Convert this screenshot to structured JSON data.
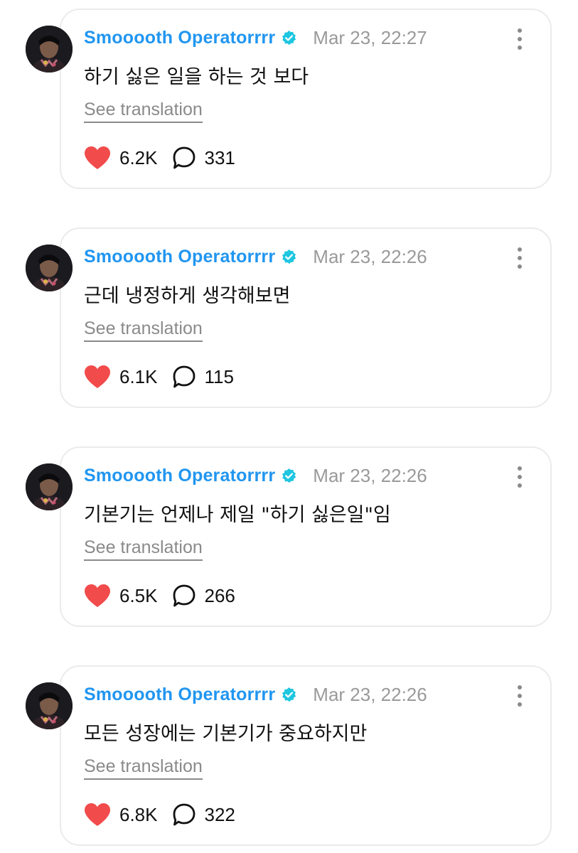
{
  "colors": {
    "accent": "#2196f0",
    "verified": "#1ec6e0",
    "like": "#f24b4b",
    "muted": "#9a9a9a"
  },
  "icons": {
    "verified": "verified-badge-icon",
    "like": "heart-icon",
    "comment": "speech-bubble-icon",
    "more": "vertical-ellipsis-icon"
  },
  "posts": [
    {
      "username": "Smooooth Operatorrrr",
      "timestamp": "Mar 23, 22:27",
      "text": "하기 싫은 일을 하는 것 보다",
      "translate_label": "See translation",
      "likes": "6.2K",
      "comments": "331"
    },
    {
      "username": "Smooooth Operatorrrr",
      "timestamp": "Mar 23, 22:26",
      "text": "근데 냉정하게 생각해보면",
      "translate_label": "See translation",
      "likes": "6.1K",
      "comments": "115"
    },
    {
      "username": "Smooooth Operatorrrr",
      "timestamp": "Mar 23, 22:26",
      "text": "기본기는 언제나 제일 \"하기 싫은일\"임",
      "translate_label": "See translation",
      "likes": "6.5K",
      "comments": "266"
    },
    {
      "username": "Smooooth Operatorrrr",
      "timestamp": "Mar 23, 22:26",
      "text": "모든 성장에는 기본기가 중요하지만",
      "translate_label": "See translation",
      "likes": "6.8K",
      "comments": "322"
    }
  ]
}
